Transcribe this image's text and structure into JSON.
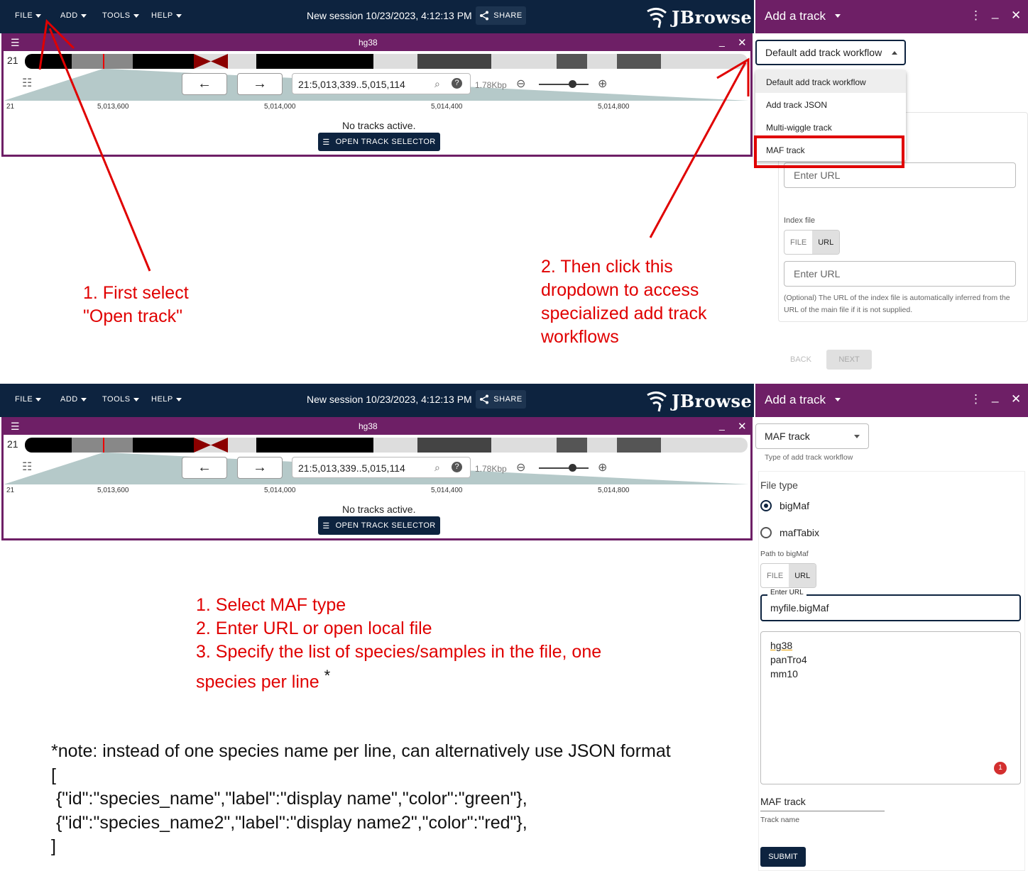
{
  "top": {
    "menus": [
      "FILE",
      "ADD",
      "TOOLS",
      "HELP"
    ],
    "session_title": "New session 10/23/2023, 4:12:13 PM",
    "share_label": "SHARE",
    "logo_text": "JBrowse",
    "view_title": "hg38",
    "chrom_label": "21",
    "locstring": "21:5,013,339..5,015,114",
    "span_label": "1.78Kbp",
    "ruler_chrom": "21",
    "ticks": [
      "5,013,600",
      "5,014,000",
      "5,014,400",
      "5,014,800"
    ],
    "no_tracks": "No tracks active.",
    "open_track_selector": "OPEN TRACK SELECTOR",
    "panel_title": "Add a track",
    "workflow_select": "Default add track workflow",
    "dropdown_items": [
      "Default add track workflow",
      "Add track JSON",
      "Multi-wiggle track",
      "MAF track"
    ],
    "enter_url_placeholder": "Enter URL",
    "index_file_label": "Index file",
    "file_label": "FILE",
    "url_label": "URL",
    "index_help": "(Optional) The URL of the index file is automatically inferred from the URL of the main file if it is not supplied.",
    "back_label": "BACK",
    "next_label": "NEXT",
    "annotation1": [
      "1. First select",
      "\"Open track\""
    ],
    "annotation2": [
      "2. Then click this",
      "dropdown to access",
      "specialized add track",
      "workflows"
    ]
  },
  "bottom": {
    "workflow_select": "MAF track",
    "workflow_helper": "Type of add track workflow",
    "file_type_label": "File type",
    "radio_options": [
      "bigMaf",
      "mafTabix"
    ],
    "path_label": "Path to bigMaf",
    "file_label": "FILE",
    "url_label": "URL",
    "enter_url_label": "Enter URL",
    "url_value": "myfile.bigMaf",
    "samples": [
      "hg38",
      "panTro4",
      "mm10"
    ],
    "badge": "1",
    "track_name_value": "MAF track",
    "track_name_label": "Track name",
    "submit_label": "SUBMIT",
    "instructions": [
      "1. Select MAF type",
      "2. Enter URL or open local file",
      "3. Specify the list of species/samples in the file, one",
      "species per line"
    ],
    "asterisk": "*",
    "note_lines": [
      "*note: instead of one species name per line, can alternatively use JSON format",
      "[",
      " {\"id\":\"species_name\",\"label\":\"display name\",\"color\":\"green\"},",
      " {\"id\":\"species_name2\",\"label\":\"display name2\",\"color\":\"red\"},",
      "]"
    ]
  },
  "colors": {
    "appbar": "#0d233f",
    "view_border": "#6e1f66",
    "annotation": "#e00000"
  }
}
